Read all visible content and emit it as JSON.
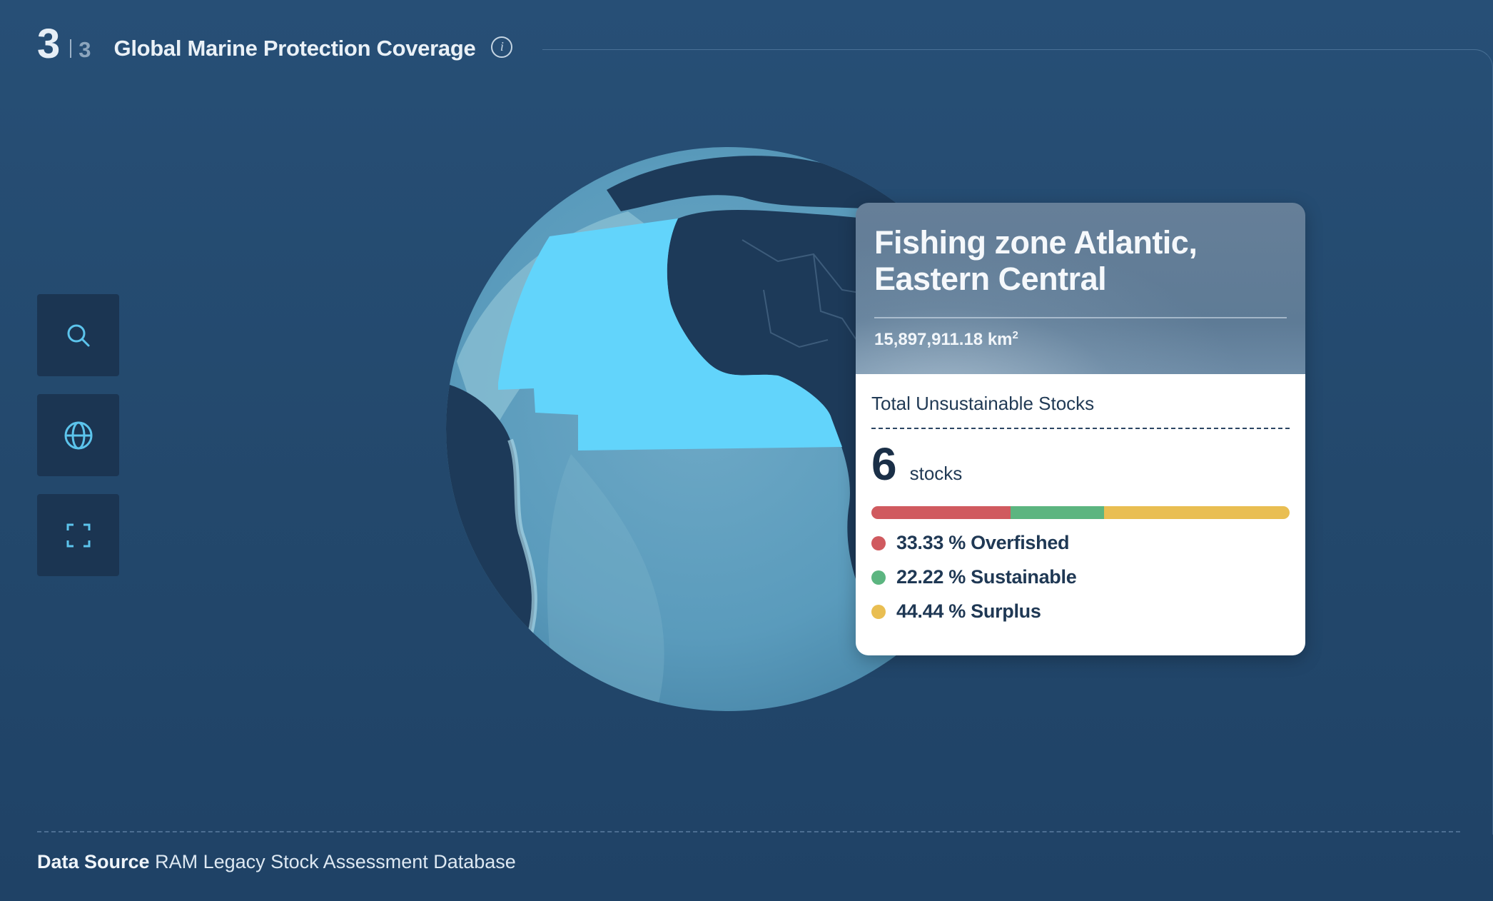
{
  "header": {
    "step_current": "3",
    "step_total": "3",
    "title": "Global Marine Protection Coverage",
    "info_icon": "info-icon"
  },
  "toolbar": {
    "buttons": [
      {
        "icon": "search-icon"
      },
      {
        "icon": "globe-icon"
      },
      {
        "icon": "fullscreen-icon"
      }
    ]
  },
  "card": {
    "title_line1": "Fishing zone Atlantic,",
    "title_line2": "Eastern Central",
    "area_value": "15,897,911.18 km",
    "area_unit_sup": "2",
    "stocks_label": "Total Unsustainable Stocks",
    "stocks_count": "6",
    "stocks_unit": "stocks",
    "breakdown": [
      {
        "label": "33.33 % Overfished",
        "percent": 33.33,
        "color": "#d05a5f"
      },
      {
        "label": "22.22 % Sustainable",
        "percent": 22.22,
        "color": "#5cb580"
      },
      {
        "label": "44.44 % Surplus",
        "percent": 44.44,
        "color": "#e9be52"
      }
    ]
  },
  "footer": {
    "source_label": "Data Source",
    "source_value": "RAM Legacy Stock Assessment Database"
  },
  "colors": {
    "background": "#244a6e",
    "highlight_zone": "#62d4fb",
    "ocean": "#5a9bbc",
    "land": "#1d3a59"
  }
}
